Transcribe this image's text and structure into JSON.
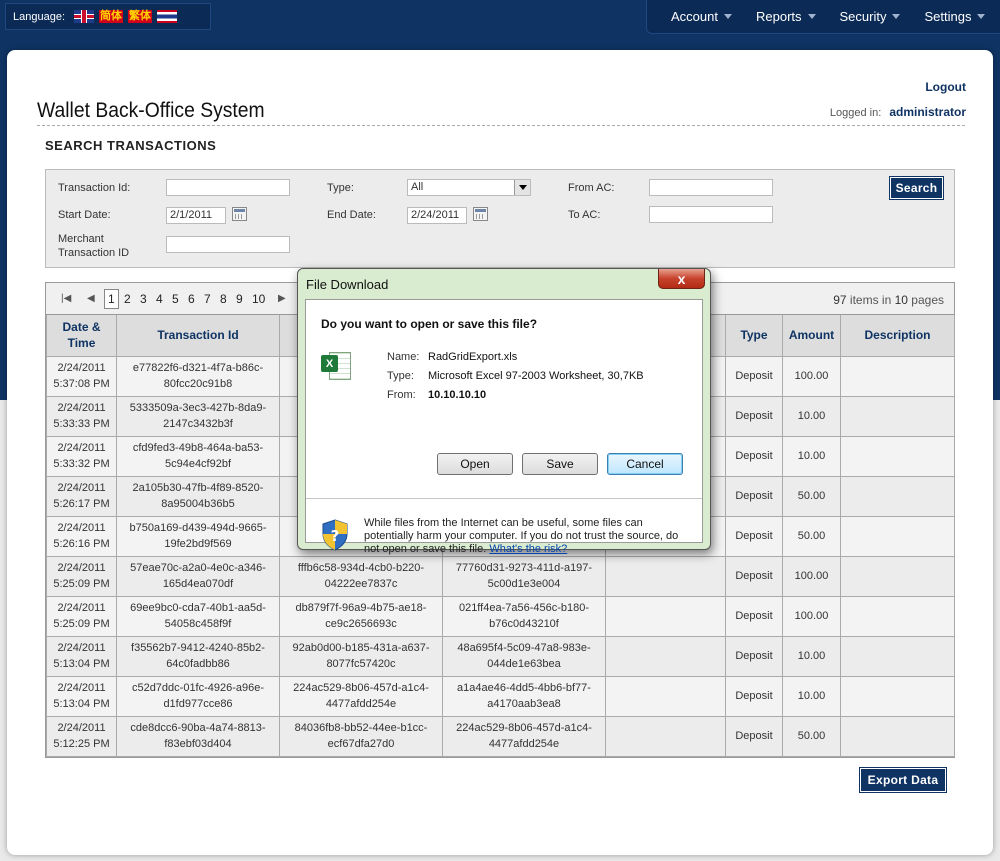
{
  "header": {
    "language_label": "Language:",
    "languages": [
      {
        "name": "English",
        "icon": "uk-flag-icon"
      },
      {
        "name": "简体",
        "icon": "cn-flag-icon"
      },
      {
        "name": "繁体",
        "icon": "tw-flag-icon"
      },
      {
        "name": "Thai",
        "icon": "th-flag-icon"
      }
    ],
    "menu": [
      "Account",
      "Reports",
      "Security",
      "Settings"
    ]
  },
  "app": {
    "title": "Wallet Back-Office System",
    "logout": "Logout",
    "logged_in_label": "Logged in:",
    "user": "administrator"
  },
  "search": {
    "section_title": "SEARCH TRANSACTIONS",
    "labels": {
      "transaction_id": "Transaction Id:",
      "type": "Type:",
      "from_ac": "From AC:",
      "start_date": "Start Date:",
      "end_date": "End Date:",
      "to_ac": "To AC:",
      "merchant_line1": "Merchant",
      "merchant_line2": "Transaction ID"
    },
    "values": {
      "transaction_id": "",
      "type": "All",
      "from_ac": "",
      "start_date": "2/1/2011",
      "end_date": "2/24/2011",
      "to_ac": "",
      "merchant_txn_id": ""
    },
    "search_button": "Search"
  },
  "grid": {
    "pager": {
      "pages": [
        "1",
        "2",
        "3",
        "4",
        "5",
        "6",
        "7",
        "8",
        "9",
        "10"
      ],
      "current": "1",
      "items_count": "97",
      "items_text": "items in",
      "pages_count": "10",
      "pages_text": "pages"
    },
    "columns": [
      "Date &\nTime",
      "Transaction Id",
      "",
      "",
      "",
      "Type",
      "Amount",
      "Description"
    ],
    "rows": [
      {
        "date": "2/24/2011",
        "time": "5:37:08 PM",
        "txn": [
          "e77822f6-d321-4f7a-b86c-",
          "80fcc20c91b8"
        ],
        "c3": [
          "",
          ""
        ],
        "c4": [
          "",
          ""
        ],
        "c5": "",
        "type": "Deposit",
        "amount": "100.00",
        "desc": ""
      },
      {
        "date": "2/24/2011",
        "time": "5:33:33 PM",
        "txn": [
          "5333509a-3ec3-427b-8da9-",
          "2147c3432b3f"
        ],
        "c3": [
          "",
          ""
        ],
        "c4": [
          "",
          ""
        ],
        "c5": "",
        "type": "Deposit",
        "amount": "10.00",
        "desc": ""
      },
      {
        "date": "2/24/2011",
        "time": "5:33:32 PM",
        "txn": [
          "cfd9fed3-49b8-464a-ba53-",
          "5c94e4cf92bf"
        ],
        "c3": [
          "",
          ""
        ],
        "c4": [
          "",
          ""
        ],
        "c5": "",
        "type": "Deposit",
        "amount": "10.00",
        "desc": ""
      },
      {
        "date": "2/24/2011",
        "time": "5:26:17 PM",
        "txn": [
          "2a105b30-47fb-4f89-8520-",
          "8a95004b36b5"
        ],
        "c3": [
          "",
          ""
        ],
        "c4": [
          "",
          ""
        ],
        "c5": "",
        "type": "Deposit",
        "amount": "50.00",
        "desc": ""
      },
      {
        "date": "2/24/2011",
        "time": "5:26:16 PM",
        "txn": [
          "b750a169-d439-494d-9665-",
          "19fe2bd9f569"
        ],
        "c3": [
          "",
          ""
        ],
        "c4": [
          "",
          ""
        ],
        "c5": "",
        "type": "Deposit",
        "amount": "50.00",
        "desc": ""
      },
      {
        "date": "2/24/2011",
        "time": "5:25:09 PM",
        "txn": [
          "57eae70c-a2a0-4e0c-a346-",
          "165d4ea070df"
        ],
        "c3": [
          "fffb6c58-934d-4cb0-b220-",
          "04222ee7837c"
        ],
        "c4": [
          "77760d31-9273-411d-a197-",
          "5c00d1e3e004"
        ],
        "c5": "",
        "type": "Deposit",
        "amount": "100.00",
        "desc": ""
      },
      {
        "date": "2/24/2011",
        "time": "5:25:09 PM",
        "txn": [
          "69ee9bc0-cda7-40b1-aa5d-",
          "54058c458f9f"
        ],
        "c3": [
          "db879f7f-96a9-4b75-ae18-",
          "ce9c2656693c"
        ],
        "c4": [
          "021ff4ea-7a56-456c-b180-",
          "b76c0d43210f"
        ],
        "c5": "",
        "type": "Deposit",
        "amount": "100.00",
        "desc": ""
      },
      {
        "date": "2/24/2011",
        "time": "5:13:04 PM",
        "txn": [
          "f35562b7-9412-4240-85b2-",
          "64c0fadbb86"
        ],
        "c3": [
          "92ab0d00-b185-431a-a637-",
          "8077fc57420c"
        ],
        "c4": [
          "48a695f4-5c09-47a8-983e-",
          "044de1e63bea"
        ],
        "c5": "",
        "type": "Deposit",
        "amount": "10.00",
        "desc": ""
      },
      {
        "date": "2/24/2011",
        "time": "5:13:04 PM",
        "txn": [
          "c52d7ddc-01fc-4926-a96e-",
          "d1fd977cce86"
        ],
        "c3": [
          "224ac529-8b06-457d-a1c4-",
          "4477afdd254e"
        ],
        "c4": [
          "a1a4ae46-4dd5-4bb6-bf77-",
          "a4170aab3ea8"
        ],
        "c5": "",
        "type": "Deposit",
        "amount": "10.00",
        "desc": ""
      },
      {
        "date": "2/24/2011",
        "time": "5:12:25 PM",
        "txn": [
          "cde8dcc6-90ba-4a74-8813-",
          "f83ebf03d404"
        ],
        "c3": [
          "84036fb8-bb52-44ee-b1cc-",
          "ecf67dfa27d0"
        ],
        "c4": [
          "224ac529-8b06-457d-a1c4-",
          "4477afdd254e"
        ],
        "c5": "",
        "type": "Deposit",
        "amount": "50.00",
        "desc": ""
      }
    ],
    "export_button": "Export Data"
  },
  "dialog": {
    "title": "File Download",
    "close_label": "x",
    "question": "Do you want to open or save this file?",
    "name_label": "Name:",
    "name_value": "RadGridExport.xls",
    "type_label": "Type:",
    "type_value": "Microsoft Excel 97-2003 Worksheet, 30,7KB",
    "from_label": "From:",
    "from_value": "10.10.10.10",
    "open_button": "Open",
    "save_button": "Save",
    "cancel_button": "Cancel",
    "warning_text": "While files from the Internet can be useful, some files can potentially harm your computer. If you do not trust the source, do not open or save this file.",
    "risk_link": "What's the risk?"
  },
  "colors": {
    "navy": "#0f3363",
    "dialog_frame": "#d9ecd0"
  }
}
